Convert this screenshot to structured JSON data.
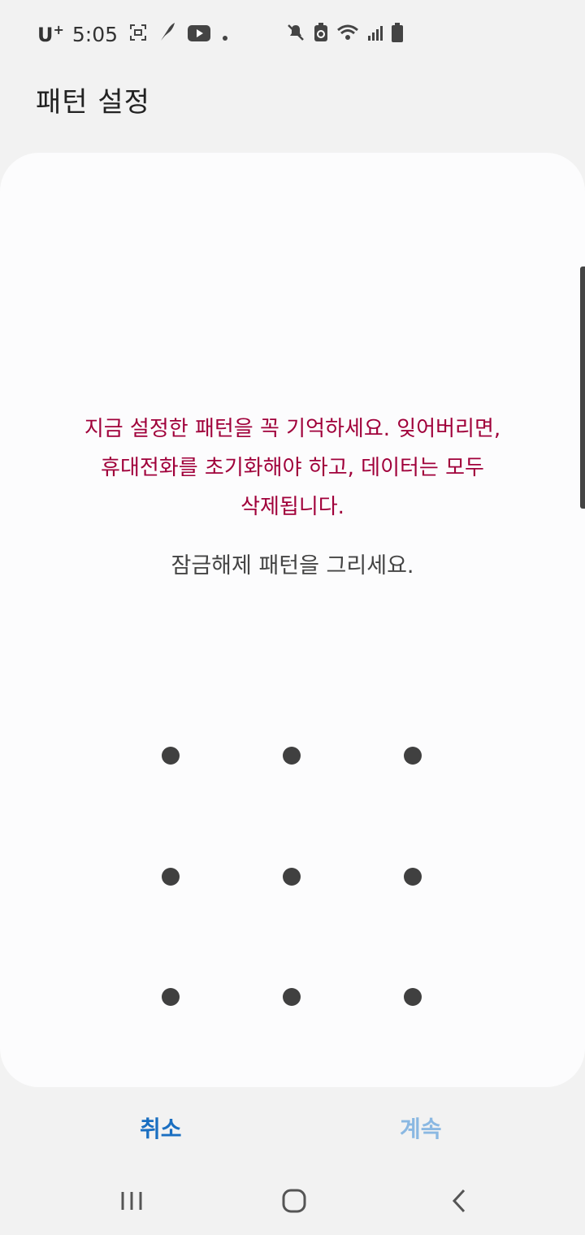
{
  "status_bar": {
    "carrier": "U",
    "carrier_sup": "+",
    "time": "5:05",
    "icons": [
      "screenshot-icon",
      "feather-icon",
      "youtube-icon",
      "dot-icon",
      "mute-icon",
      "battery-saver-icon",
      "wifi-icon",
      "signal-icon",
      "battery-icon"
    ]
  },
  "header": {
    "title": "패턴 설정"
  },
  "main": {
    "warning": "지금 설정한 패턴을 꼭 기억하세요. 잊어버리면,\n휴대전화를 초기화해야 하고, 데이터는 모두\n삭제됩니다.",
    "instruction": "잠금해제 패턴을 그리세요.",
    "pattern_grid": {
      "rows": 3,
      "cols": 3
    }
  },
  "buttons": {
    "cancel": "취소",
    "continue": "계속"
  },
  "nav": {
    "icons": [
      "recent-apps-icon",
      "home-icon",
      "back-icon"
    ]
  },
  "colors": {
    "warning": "#a0003a",
    "accent": "#1a6fc1",
    "accent_disabled": "#8ab8e2"
  }
}
